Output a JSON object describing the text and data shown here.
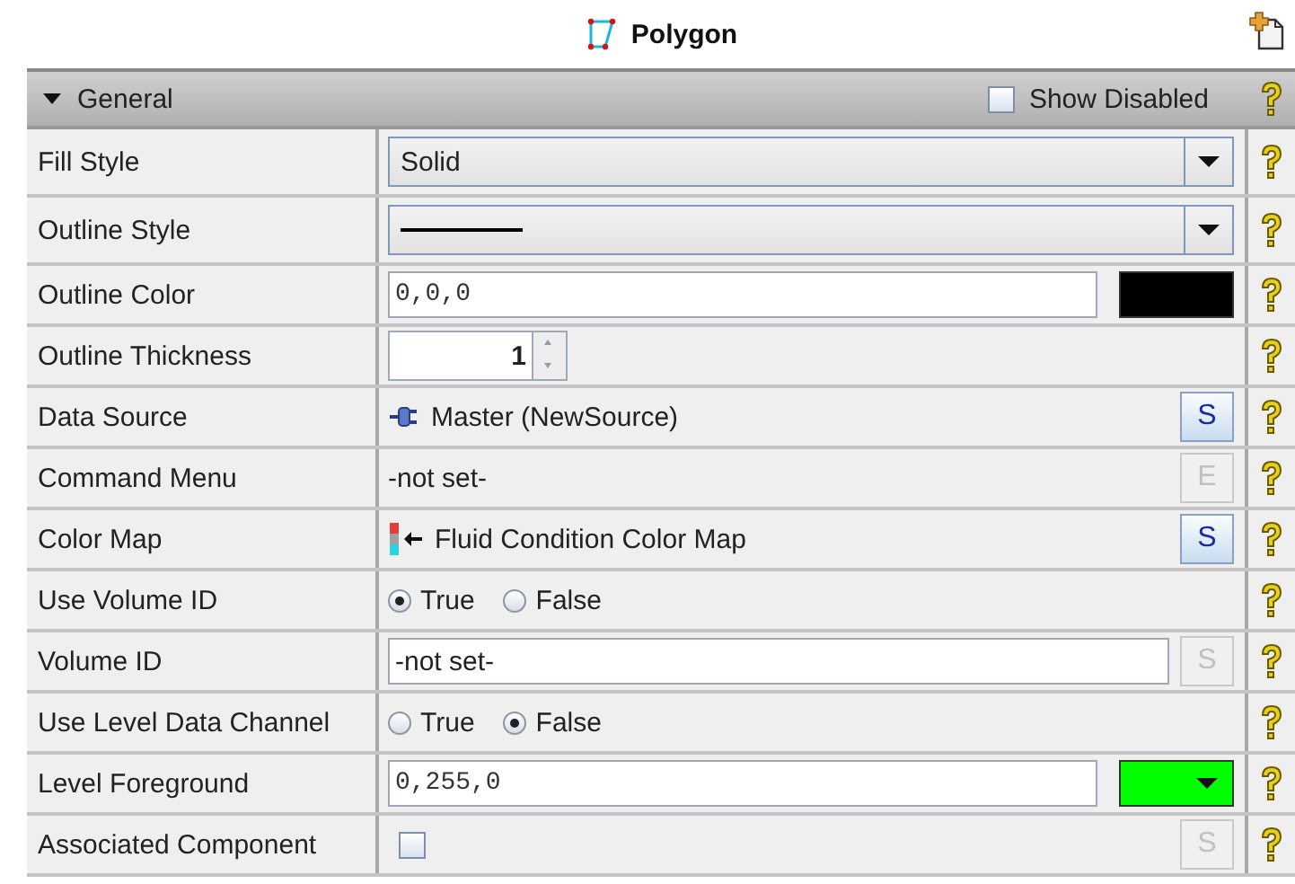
{
  "title": "Polygon",
  "section": {
    "label": "General",
    "expanded": true,
    "show_disabled": {
      "label": "Show Disabled",
      "checked": false
    }
  },
  "rows": [
    {
      "label": "Fill Style",
      "kind": "combo",
      "value": "Solid"
    },
    {
      "label": "Outline Style",
      "kind": "line_combo"
    },
    {
      "label": "Outline Color",
      "kind": "color",
      "value": "0,0,0",
      "color": "#000000",
      "dropdown": false
    },
    {
      "label": "Outline Thickness",
      "kind": "spinner",
      "value": "1"
    },
    {
      "label": "Data Source",
      "kind": "source",
      "value": "Master (NewSource)",
      "button": {
        "label": "S",
        "disabled": false
      }
    },
    {
      "label": "Command Menu",
      "kind": "command",
      "value": "-not set-",
      "button": {
        "label": "E",
        "disabled": true
      }
    },
    {
      "label": "Color Map",
      "kind": "colormap",
      "value": "Fluid Condition Color Map",
      "button": {
        "label": "S",
        "disabled": false
      }
    },
    {
      "label": "Use Volume ID",
      "kind": "radio",
      "options": [
        {
          "label": "True",
          "selected": true
        },
        {
          "label": "False",
          "selected": false
        }
      ]
    },
    {
      "label": "Volume ID",
      "kind": "field",
      "value": "-not set-",
      "button": {
        "label": "S",
        "disabled": true
      }
    },
    {
      "label": "Use Level Data Channel",
      "kind": "radio",
      "options": [
        {
          "label": "True",
          "selected": false
        },
        {
          "label": "False",
          "selected": true
        }
      ]
    },
    {
      "label": "Level Foreground",
      "kind": "color",
      "value": "0,255,0",
      "color": "#00ff00",
      "dropdown": true
    },
    {
      "label": "Associated Component",
      "kind": "checkbox",
      "checked": false,
      "button": {
        "label": "S",
        "disabled": true
      }
    }
  ]
}
